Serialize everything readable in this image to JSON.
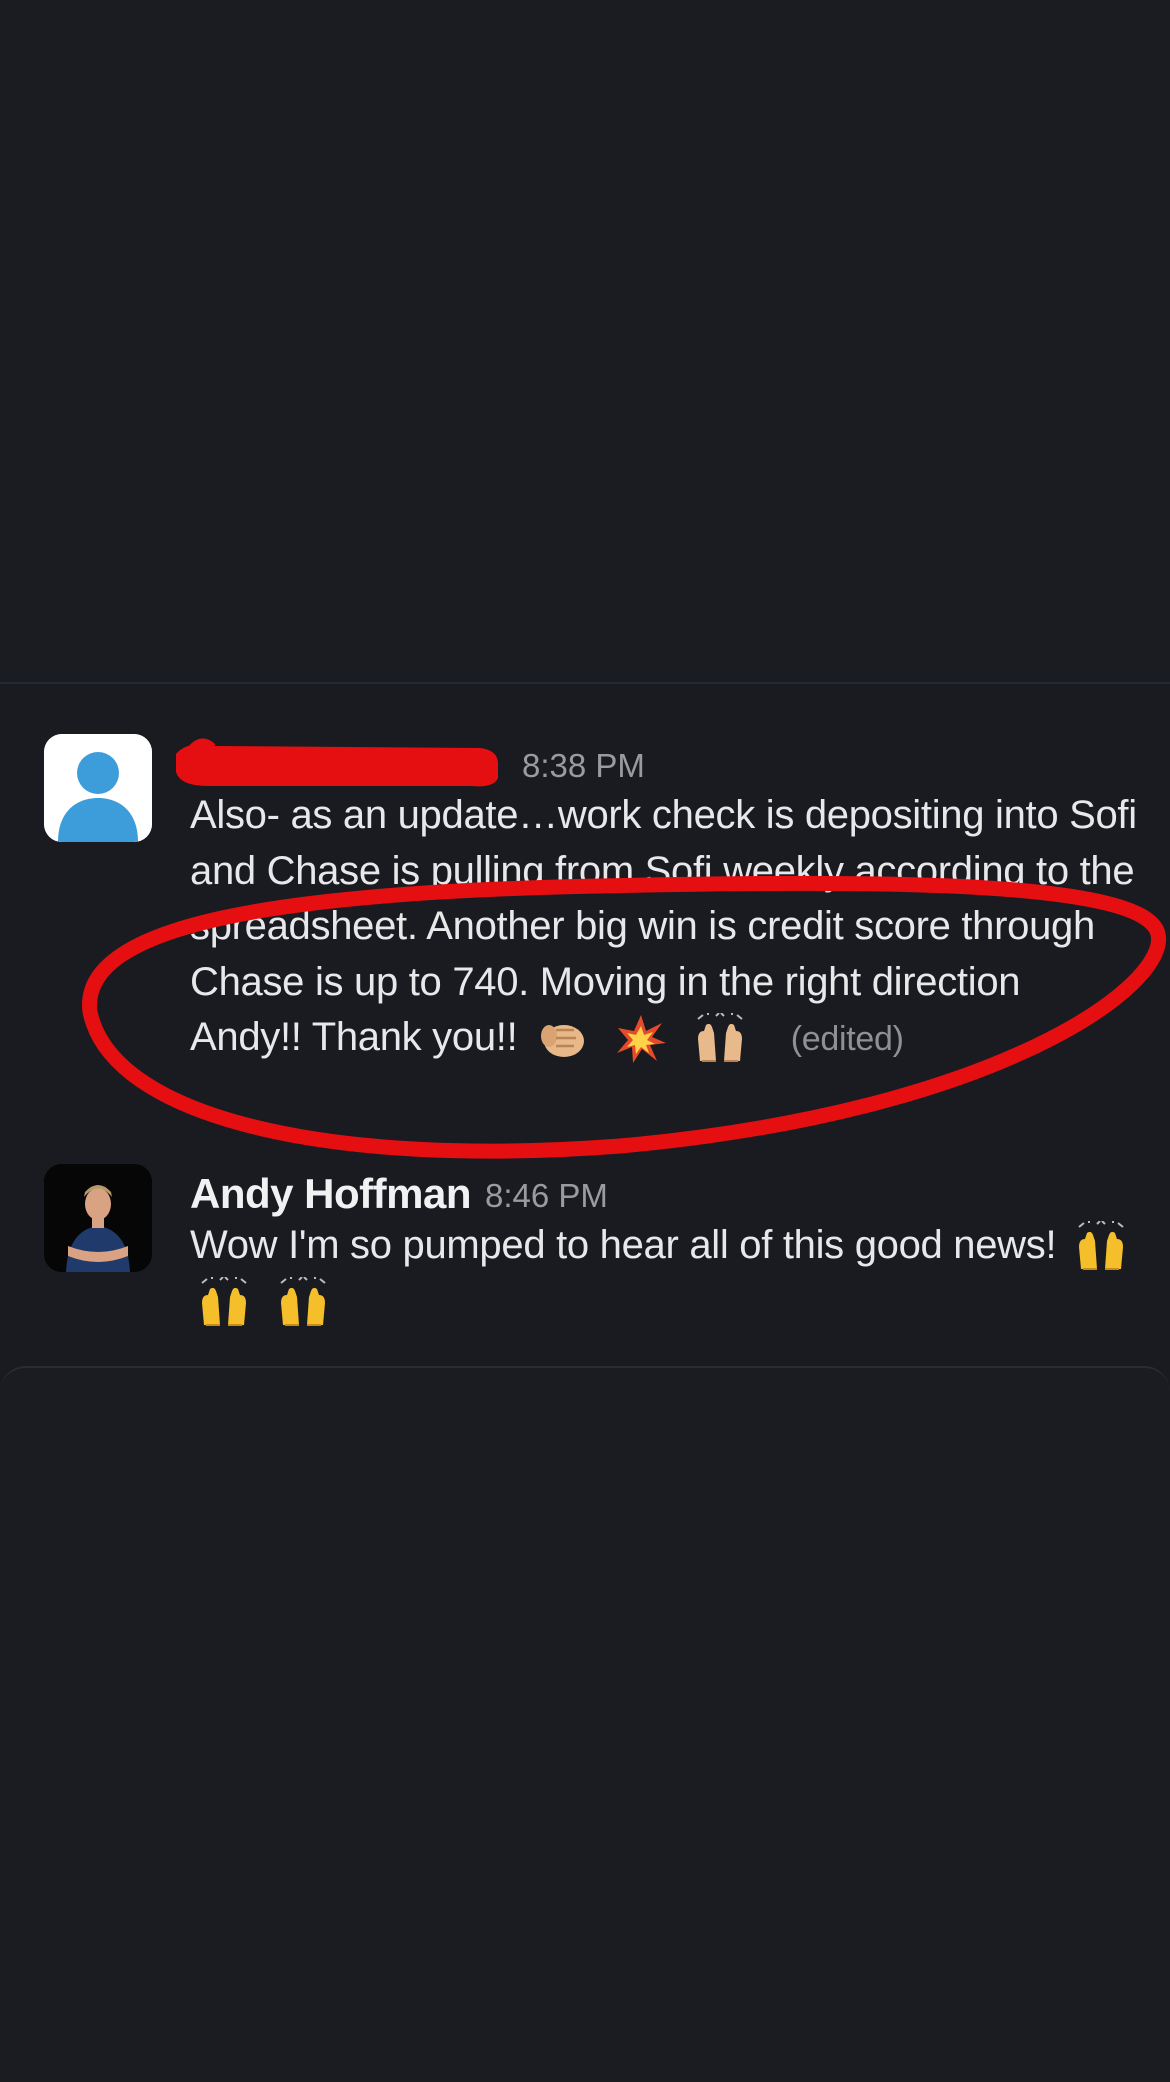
{
  "messages": [
    {
      "sender": "",
      "time": "8:38 PM",
      "text": "Also- as an update…work check is depositing into Sofi and Chase is pulling from Sofi weekly according to the spreadsheet.  Another big win is credit score through Chase is up to 740. Moving in the right direction Andy!! Thank you!!",
      "emojis": [
        "oncoming-fist",
        "collision",
        "raising-hands-light"
      ],
      "edited": "(edited)"
    },
    {
      "sender": "Andy Hoffman",
      "time": "8:46 PM",
      "text": "Wow I'm so pumped to hear all of this good news!",
      "emojis": [
        "raising-hands",
        "raising-hands",
        "raising-hands"
      ]
    }
  ],
  "annotations": {
    "highlight_color": "#e50f12",
    "redaction_color": "#e50f12"
  }
}
